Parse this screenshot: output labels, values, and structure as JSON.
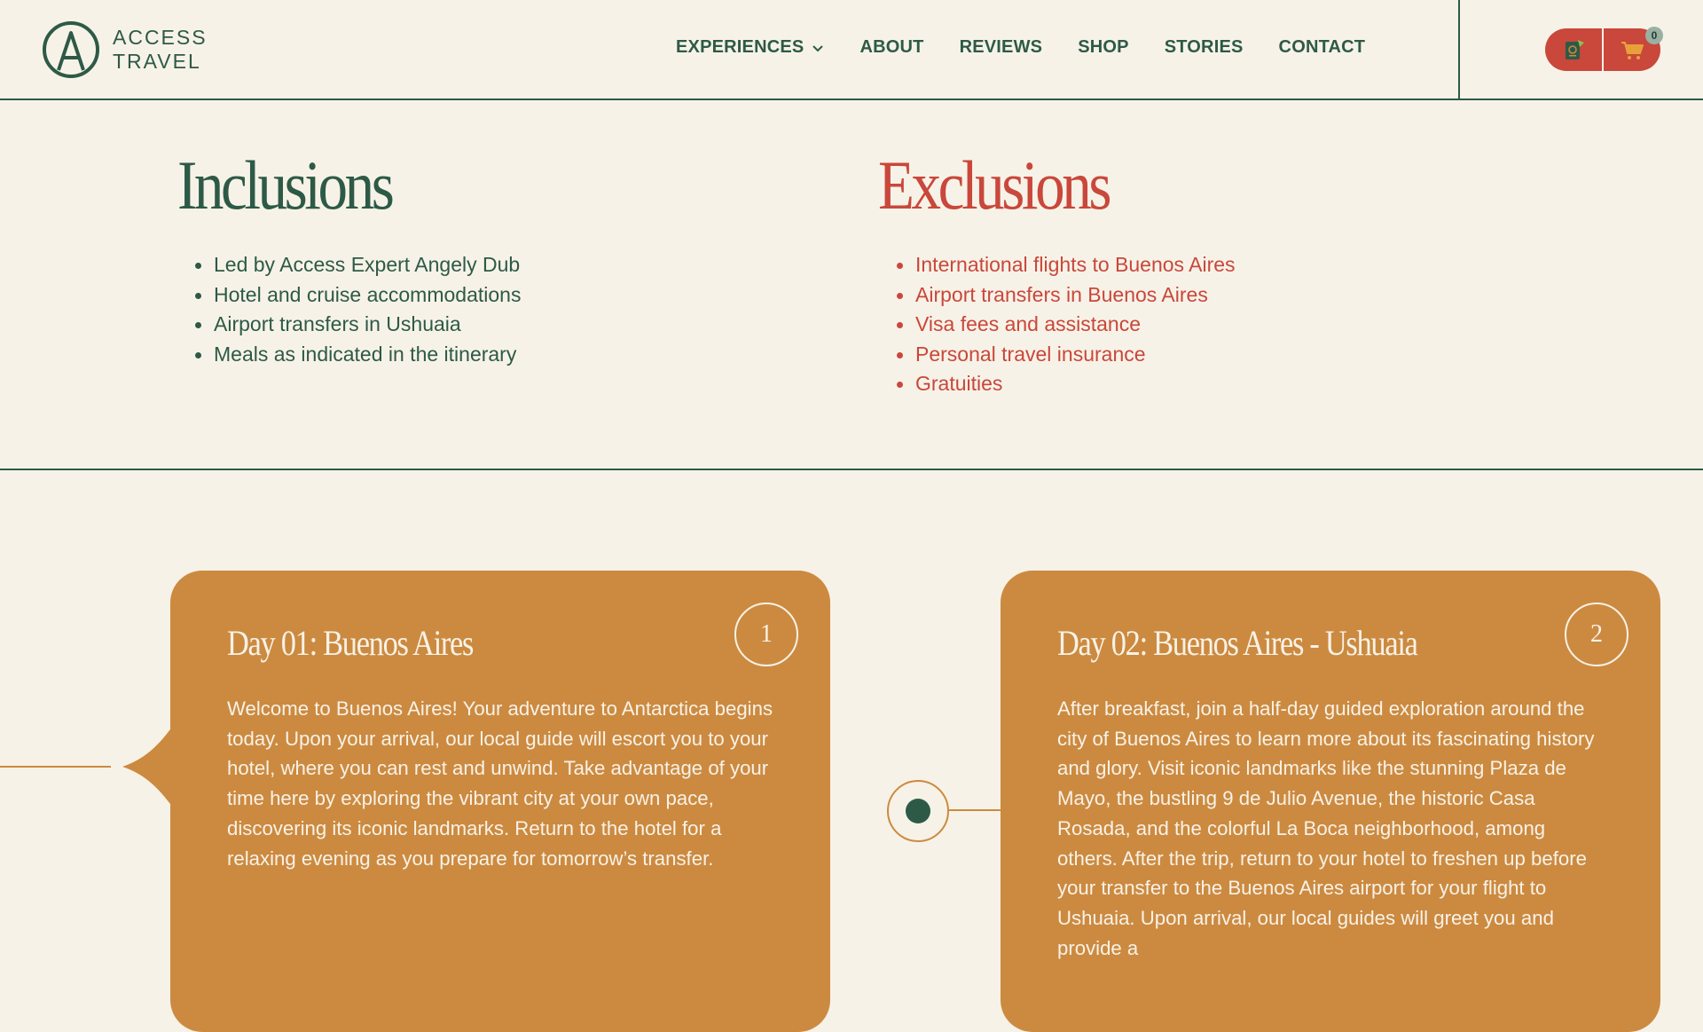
{
  "brand": {
    "line1": "ACCESS",
    "line2": "TRAVEL"
  },
  "nav": {
    "items": [
      "EXPERIENCES",
      "ABOUT",
      "REVIEWS",
      "SHOP",
      "STORIES",
      "CONTACT"
    ]
  },
  "header_actions": {
    "passport_icon": "passport-icon",
    "cart_icon": "cart-icon",
    "cart_count": "0",
    "accent_color": "#c9473b"
  },
  "inclusions": {
    "title": "Inclusions",
    "items": [
      "Led by Access Expert Angely Dub",
      "Hotel and cruise accommodations",
      "Airport transfers in Ushuaia",
      "Meals as indicated in the itinerary"
    ]
  },
  "exclusions": {
    "title": "Exclusions",
    "items": [
      "International flights to Buenos Aires",
      "Airport transfers in Buenos Aires",
      "Visa fees and assistance",
      "Personal travel insurance",
      "Gratuities"
    ]
  },
  "itinerary": [
    {
      "number": "1",
      "title": "Day 01: Buenos Aires",
      "body": "Welcome to Buenos Aires! Your adventure to Antarctica begins today. Upon your arrival, our local guide will escort you to your hotel, where you can rest and unwind. Take advantage of your time here by exploring the vibrant city at your own pace, discovering its iconic landmarks. Return to the hotel for a relaxing evening as you prepare for tomorrow’s transfer."
    },
    {
      "number": "2",
      "title": "Day 02: Buenos Aires - Ushuaia",
      "body": "After breakfast, join a half-day guided exploration around the city of Buenos Aires to learn more about its fascinating history and glory. Visit iconic landmarks like the stunning Plaza de Mayo, the bustling 9 de Julio Avenue, the historic Casa Rosada, and the colorful La Boca neighborhood, among others. After the trip, return to your hotel to freshen up before your transfer to the Buenos Aires airport for your flight to Ushuaia. Upon arrival, our local guides will greet you and provide a"
    }
  ],
  "colors": {
    "background": "#f7f2e7",
    "primary_green": "#2d5a47",
    "accent_red": "#c9473b",
    "card_orange": "#cc8a40"
  }
}
